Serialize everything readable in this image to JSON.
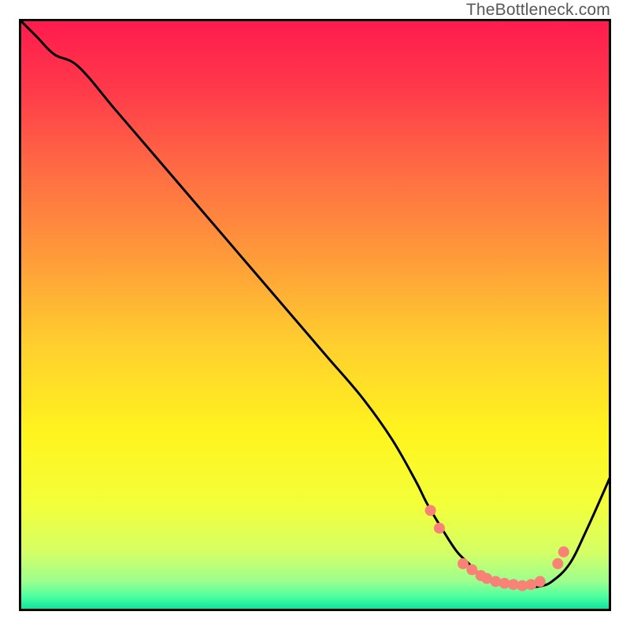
{
  "watermark": "TheBottleneck.com",
  "chart_data": {
    "type": "line",
    "title": "",
    "xlabel": "",
    "ylabel": "",
    "xlim": [
      0,
      100
    ],
    "ylim": [
      0,
      100
    ],
    "background_gradient_stops": [
      {
        "offset": 0,
        "color": "#ff1a4e"
      },
      {
        "offset": 0.12,
        "color": "#ff3a4a"
      },
      {
        "offset": 0.25,
        "color": "#ff6a44"
      },
      {
        "offset": 0.4,
        "color": "#ff9a3a"
      },
      {
        "offset": 0.55,
        "color": "#ffcf2e"
      },
      {
        "offset": 0.7,
        "color": "#fff41e"
      },
      {
        "offset": 0.82,
        "color": "#f3ff3a"
      },
      {
        "offset": 0.9,
        "color": "#d5ff65"
      },
      {
        "offset": 0.95,
        "color": "#9cff8e"
      },
      {
        "offset": 0.975,
        "color": "#4effa0"
      },
      {
        "offset": 1.0,
        "color": "#00e29a"
      }
    ],
    "series": [
      {
        "name": "bottleneck-curve",
        "x": [
          0,
          3,
          6,
          10,
          16,
          22,
          28,
          34,
          40,
          46,
          52,
          58,
          63,
          67,
          69,
          72,
          74,
          76,
          78,
          80,
          82,
          84,
          86,
          88,
          90,
          93,
          96,
          100
        ],
        "y": [
          100,
          97,
          94,
          92,
          85,
          78,
          71,
          64,
          57,
          50,
          43,
          36,
          29,
          22,
          18,
          13,
          10,
          8,
          6,
          5,
          4.5,
          4.2,
          4.0,
          4.2,
          5,
          8,
          14,
          23
        ]
      }
    ],
    "markers": {
      "name": "recommended-range",
      "color": "#f98276",
      "radius": 7,
      "points": [
        {
          "x": 69.5,
          "y": 17
        },
        {
          "x": 71,
          "y": 14
        },
        {
          "x": 75,
          "y": 8
        },
        {
          "x": 76.5,
          "y": 7
        },
        {
          "x": 78,
          "y": 6
        },
        {
          "x": 79,
          "y": 5.5
        },
        {
          "x": 80.5,
          "y": 5
        },
        {
          "x": 82,
          "y": 4.7
        },
        {
          "x": 83.5,
          "y": 4.5
        },
        {
          "x": 85,
          "y": 4.3
        },
        {
          "x": 86.5,
          "y": 4.5
        },
        {
          "x": 88,
          "y": 5
        },
        {
          "x": 91,
          "y": 8
        },
        {
          "x": 92,
          "y": 10
        }
      ]
    }
  }
}
